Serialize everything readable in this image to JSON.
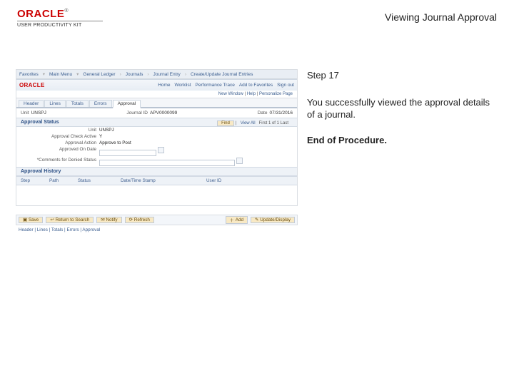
{
  "header": {
    "brand_name": "ORACLE",
    "brand_tm": "®",
    "brand_sub": "USER PRODUCTIVITY KIT",
    "doc_title": "Viewing Journal Approval"
  },
  "instruction": {
    "step": "Step 17",
    "desc": "You successfully viewed the approval details of a journal.",
    "end": "End of Procedure."
  },
  "app": {
    "topnav": {
      "items": [
        "Favorites",
        "Main Menu",
        "General Ledger",
        "Journals",
        "Journal Entry",
        "Create/Update Journal Entries"
      ]
    },
    "logo": "ORACLE",
    "subnav": {
      "items": [
        "Home",
        "Worklist",
        "Performance Trace",
        "Add to Favorites",
        "Sign out"
      ]
    },
    "menurow": {
      "newwin": "New Window",
      "help": "Help",
      "personalize": "Personalize Page"
    },
    "tabs": [
      "Header",
      "Lines",
      "Totals",
      "Errors",
      "Approval"
    ],
    "active_tab": "Approval",
    "id": {
      "unit_k": "Unit",
      "unit_v": "UNSPJ",
      "jid_k": "Journal ID",
      "jid_v": "APV0000099",
      "date_k": "Date",
      "date_v": "07/31/2016"
    },
    "find": {
      "btn": "Find",
      "viewall": "View All",
      "range": "First  1 of 1  Last"
    },
    "section_title": "Approval Status",
    "kv": {
      "unit2_k": "Unit",
      "unit2_v": "UNSPJ",
      "ack_k": "Approval Check Active",
      "ack_v": "Y",
      "act_k": "Approval Action",
      "act_v": "Approve to Post",
      "adt_k": "Approved On Date",
      "adt_v": "",
      "cmt_k": "*Comments for Denied Status"
    },
    "history_title": "Approval History",
    "grid": {
      "c1": "Step",
      "c2": "Path",
      "c3": "Status",
      "c4": "Date/Time Stamp",
      "c5": "User ID"
    }
  },
  "status": {
    "save": "Save",
    "ret": "Return to Search",
    "notify": "Notify",
    "refresh": "Refresh",
    "add": "Add",
    "upd": "Update/Display"
  },
  "breadcrumb": "Header | Lines | Totals | Errors | Approval"
}
